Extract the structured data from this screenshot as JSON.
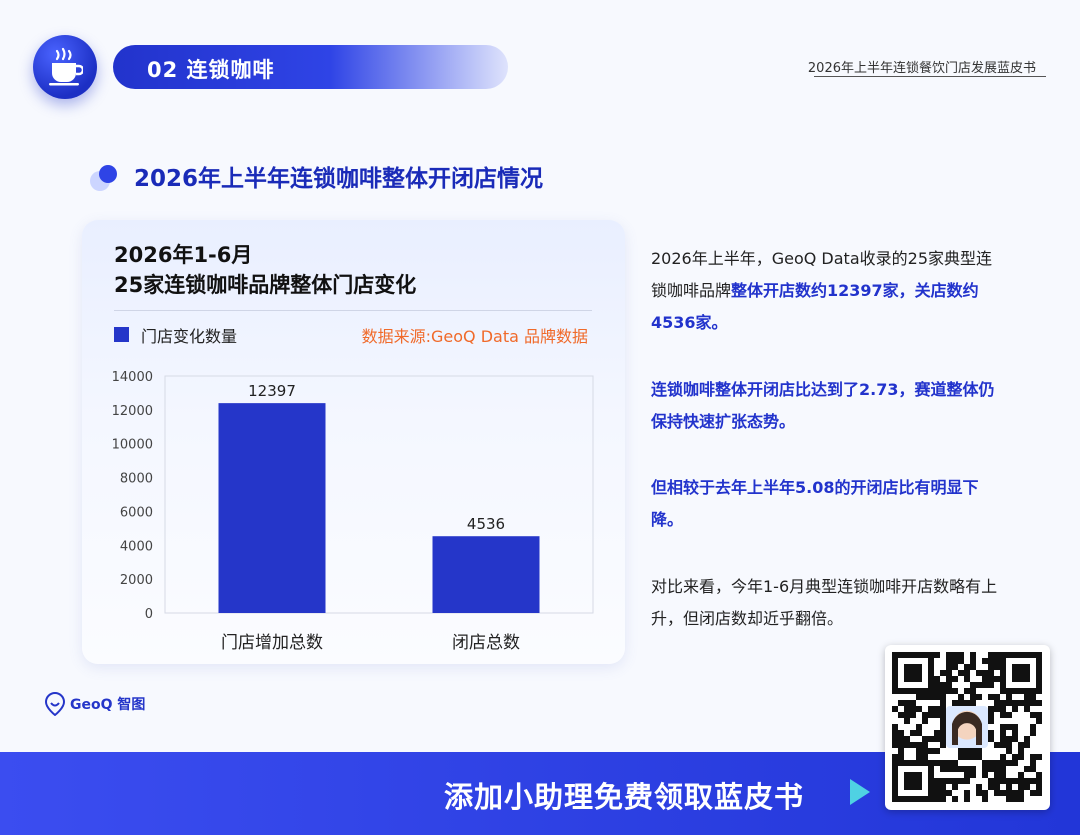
{
  "header": {
    "section_label": "02 连锁咖啡",
    "doc_title": "2026年上半年连锁餐饮门店发展蓝皮书"
  },
  "section_heading": "2026年上半年连锁咖啡整体开闭店情况",
  "chart_panel": {
    "title_line1": "2026年1-6月",
    "title_line2": "25家连锁咖啡品牌整体门店变化",
    "legend_label": "门店变化数量",
    "source_note": "数据来源:GeoQ Data 品牌数据"
  },
  "chart_data": {
    "type": "bar",
    "categories": [
      "门店增加总数",
      "闭店总数"
    ],
    "series": [
      {
        "name": "门店变化数量",
        "values": [
          12397,
          4536
        ]
      }
    ],
    "ylim": [
      0,
      14000
    ],
    "yticks": [
      0,
      2000,
      4000,
      6000,
      8000,
      10000,
      12000,
      14000
    ],
    "data_labels": [
      "12397",
      "4536"
    ],
    "bar_color": "#2536c9",
    "grid": false
  },
  "text_blocks": {
    "p1_a": "2026年上半年，GeoQ Data收录的25家典型连锁咖啡品牌",
    "p1_b": "整体开店数约12397家，关店数约4536家。",
    "p2": "连锁咖啡整体开闭店比达到了2.73，赛道整体仍保持快速扩张态势。",
    "p3": "但相较于去年上半年5.08的开闭店比有明显下降。",
    "p4": "对比来看，今年1-6月典型连锁咖啡开店数略有上升，但闭店数却近乎翻倍。"
  },
  "logo_text": "GeoQ 智图",
  "footer": {
    "cta": "添加小助理免费领取蓝皮书"
  },
  "colors": {
    "accent": "#2233cc",
    "bar": "#2536c9",
    "source_orange": "#f06a2a",
    "footer_blue": "#2236d8"
  }
}
